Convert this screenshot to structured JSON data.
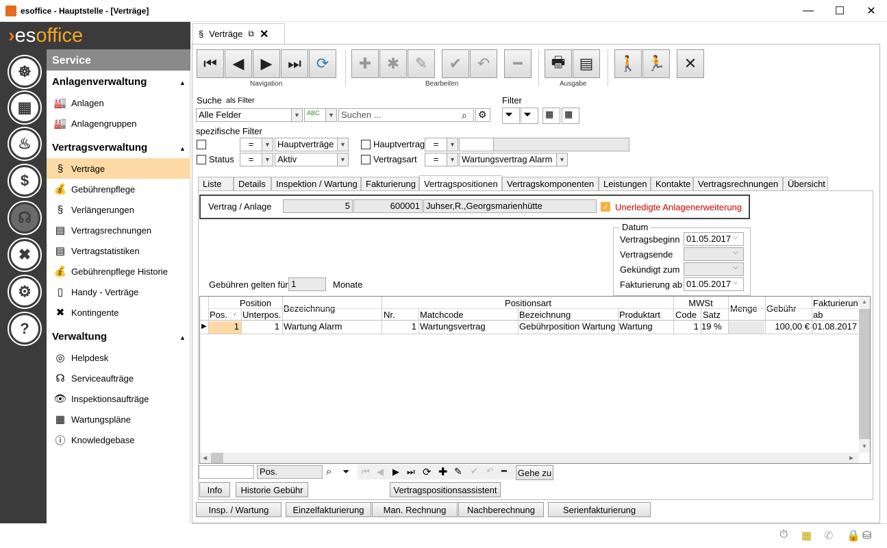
{
  "window": {
    "title": "esoffice - Hauptstelle - [Verträge]"
  },
  "logo": {
    "prefix": "es",
    "suffix": "office"
  },
  "sidebar": {
    "section": "Service",
    "groups": [
      {
        "title": "Anlagenverwaltung",
        "items": [
          "Anlagen",
          "Anlagengruppen"
        ]
      },
      {
        "title": "Vertragsverwaltung",
        "items": [
          "Verträge",
          "Gebührenpflege",
          "Verlängerungen",
          "Vertragsrechnungen",
          "Vertragstatistiken",
          "Gebührenpflege Historie",
          "Handy - Verträge",
          "Kontingente"
        ]
      },
      {
        "title": "Verwaltung",
        "items": [
          "Helpdesk",
          "Serviceaufträge",
          "Inspektionsaufträge",
          "Wartungspläne",
          "Knowledgebase"
        ]
      }
    ]
  },
  "doc_tab": {
    "label": "Verträge",
    "symbol": "§"
  },
  "toolbar": {
    "nav_label": "Navigation",
    "edit_label": "Bearbeiten",
    "output_label": "Ausgabe"
  },
  "search": {
    "label": "Suche",
    "as_filter": "als Filter",
    "field_value": "Alle Felder",
    "placeholder": "Suchen ..."
  },
  "filter": {
    "label": "Filter",
    "specific_label": "spezifische Filter",
    "row1": {
      "op": "=",
      "value": "Hauptverträge",
      "label2": "Hauptvertrag",
      "op2": "="
    },
    "row2": {
      "label": "Status",
      "op": "=",
      "value": "Aktiv",
      "label2": "Vertragsart",
      "op2": "=",
      "value2": "Wartungsvertrag Alarm"
    }
  },
  "tabs": [
    "Liste",
    "Details",
    "Inspektion / Wartung",
    "Fakturierung",
    "Vertragspositionen",
    "Vertragskomponenten",
    "Leistungen",
    "Kontakte",
    "Vertragsrechnungen",
    "Übersicht"
  ],
  "contract": {
    "label": "Vertrag / Anlage",
    "num": "5",
    "anlage": "600001",
    "name": "Juhser,R.,Georgsmarienhütte",
    "warning": "Unerledigte Anlagenerweiterung"
  },
  "datum": {
    "title": "Datum",
    "begin_label": "Vertragsbeginn",
    "begin": "01.05.2017",
    "end_label": "Vertragsende",
    "kuend_label": "Gekündigt zum",
    "fakt_label": "Fakturierung ab",
    "fakt": "01.05.2017"
  },
  "gebuehren": {
    "label": "Gebühren gelten für",
    "value": "1",
    "unit": "Monate"
  },
  "grid": {
    "h_position": "Position",
    "h_pos": "Pos.",
    "h_unterpos": "Unterpos.",
    "h_bez": "Bezeichnung",
    "h_positionsart": "Positionsart",
    "h_nr": "Nr.",
    "h_matchcode": "Matchcode",
    "h_bez2": "Bezeichnung",
    "h_produktart": "Produktart",
    "h_mwst": "MWSt",
    "h_code": "Code",
    "h_satz": "Satz",
    "h_menge": "Menge",
    "h_gebuehr": "Gebühr",
    "h_fakt1": "Fakturierung",
    "h_fakt2": "ab",
    "row": {
      "pos": "1",
      "unterpos": "1",
      "bez": "Wartung Alarm",
      "nr": "1",
      "matchcode": "Wartungsvertrag",
      "bez2": "Gebührposition Wartung",
      "produktart": "Wartung",
      "code": "1",
      "satz": "19 %",
      "menge": "",
      "gebuehr": "100,00 €",
      "fakt": "01.08.2017"
    }
  },
  "gridnav": {
    "field2": "Pos.",
    "goto": "Gehe zu"
  },
  "buttons": {
    "info": "Info",
    "historie": "Historie Gebühr",
    "assistent": "Vertragspositionsassistent",
    "bottom": [
      "Insp. / Wartung",
      "Einzelfakturierung",
      "Man. Rechnung",
      "Nachberechnung",
      "Serienfakturierung"
    ]
  }
}
